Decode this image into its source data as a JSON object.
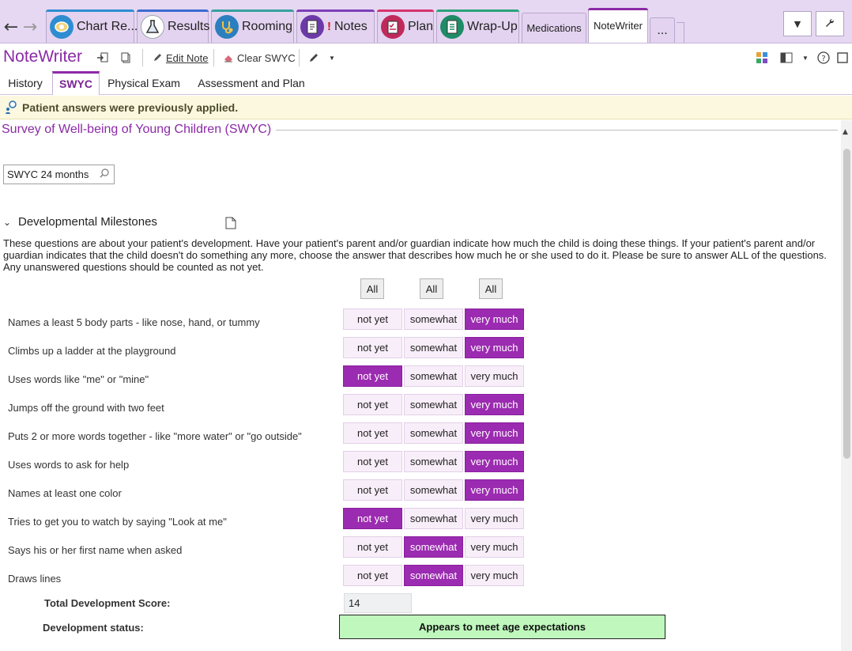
{
  "activity_tabs": [
    {
      "label": "Chart Re...",
      "icon": "chart-review-icon",
      "accent": "#2e8dd1"
    },
    {
      "label": "Results",
      "icon": "flask-icon",
      "accent": "#3b6bd0"
    },
    {
      "label": "Rooming",
      "icon": "stethoscope-icon",
      "accent": "#37a0a0"
    },
    {
      "label": "Notes",
      "icon": "notes-icon",
      "accent": "#7c3fb8"
    },
    {
      "label": "Plan",
      "icon": "plan-icon",
      "accent": "#d6336c"
    },
    {
      "label": "Wrap-Up",
      "icon": "wrap-up-icon",
      "accent": "#2aa37a"
    },
    {
      "label": "Medications"
    },
    {
      "label": "NoteWriter"
    },
    {
      "label": "..."
    }
  ],
  "app": {
    "title": "NoteWriter",
    "edit_note": "Edit Note",
    "clear_swyc": "Clear SWYC"
  },
  "sub_tabs": [
    "History",
    "SWYC",
    "Physical Exam",
    "Assessment and Plan"
  ],
  "banner": "Patient answers were previously applied.",
  "section_title": "Survey of Well-being of Young Children (SWYC)",
  "form_selector": "SWYC 24 months",
  "dev": {
    "header": "Developmental Milestones",
    "instructions": "These questions are about your patient's development. Have your patient's parent and/or guardian indicate how much the child is doing these things. If your patient's parent and/or guardian indicates that the child doesn't do something any more, choose the answer that describes how much he or she used to do it. Please be sure to answer ALL of the questions. Any unanswered questions should be counted as not yet.",
    "all_label": "All",
    "options": [
      "not yet",
      "somewhat",
      "very much"
    ],
    "questions": [
      {
        "text": "Names a least 5 body parts - like nose, hand, or tummy",
        "selected": 2
      },
      {
        "text": "Climbs up a ladder at the playground",
        "selected": 2
      },
      {
        "text": "Uses words like \"me\" or \"mine\"",
        "selected": 0
      },
      {
        "text": "Jumps off the ground with two feet",
        "selected": 2
      },
      {
        "text": "Puts 2 or more words together - like \"more water\" or \"go outside\"",
        "selected": 2
      },
      {
        "text": "Uses words to ask for help",
        "selected": 2
      },
      {
        "text": "Names at least one color",
        "selected": 2
      },
      {
        "text": "Tries to get you to watch by saying \"Look at me\"",
        "selected": 0
      },
      {
        "text": "Says his or her first name when asked",
        "selected": 1
      },
      {
        "text": "Draws lines",
        "selected": 1
      }
    ],
    "score_label": "Total Development Score:",
    "score_value": "14",
    "status_label": "Development status:",
    "status_value": "Appears to meet age expectations",
    "status_color": "#bff7bd",
    "selected_color": "#9b2bb0",
    "accent_color": "#8b2aa6"
  }
}
